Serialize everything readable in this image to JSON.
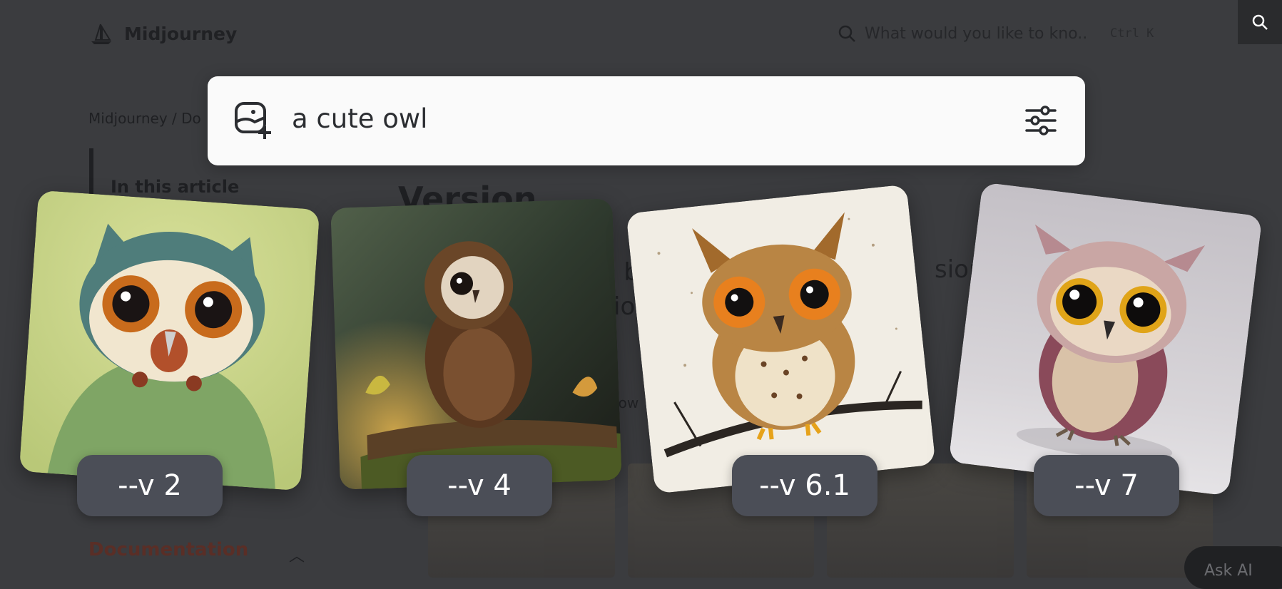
{
  "colors": {
    "overlay_bg": "#3b3c3f",
    "prompt_bg": "#fafafa",
    "badge_bg": "#4b4e57",
    "badge_text": "#ffffff",
    "doc_nav_accent": "#5a2e26"
  },
  "background": {
    "logo_text": "Midjourney",
    "search_placeholder": "What would you like to kno...",
    "search_shortcut": "Ctrl K",
    "breadcrumb": "Midjourney  /   Do",
    "toc_title": "In this article",
    "heading": "Version",
    "text_fragment_1": "sions",
    "text_fragment_2": "io",
    "text_fragment_3": "e ow",
    "text_fragment_4": "n b",
    "doc_nav": "Documentation",
    "ask_ai": "Ask AI"
  },
  "prompt": {
    "text": "a cute owl",
    "image_icon": "image-add-icon",
    "settings_icon": "sliders-icon"
  },
  "cards": [
    {
      "label": "--v 2",
      "image": "owl-v2-image"
    },
    {
      "label": "--v 4",
      "image": "owl-v4-image"
    },
    {
      "label": "--v 6.1",
      "image": "owl-v6-1-image"
    },
    {
      "label": "--v 7",
      "image": "owl-v7-image"
    }
  ]
}
